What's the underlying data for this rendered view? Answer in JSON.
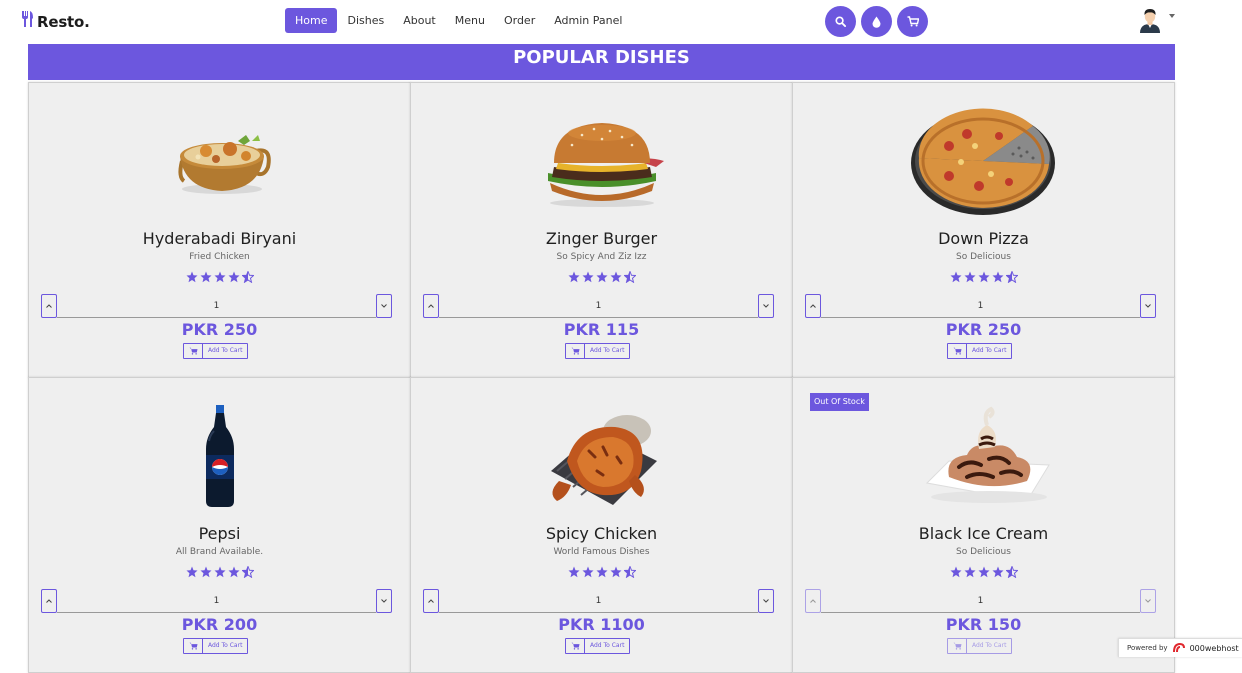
{
  "brand": {
    "name": "Resto.",
    "icon": "fork-knife-icon"
  },
  "nav": {
    "links": [
      {
        "label": "Home",
        "active": true
      },
      {
        "label": "Dishes",
        "active": false
      },
      {
        "label": "About",
        "active": false
      },
      {
        "label": "Menu",
        "active": false
      },
      {
        "label": "Order",
        "active": false
      },
      {
        "label": "Admin Panel",
        "active": false
      }
    ],
    "icons": [
      "search-icon",
      "theme-drop-icon",
      "cart-icon"
    ],
    "user_icon": "user-avatar-icon"
  },
  "banner": {
    "title": "POPULAR DISHES"
  },
  "accent_color": "#6c57de",
  "rating_icon": "star-icon",
  "dishes": [
    {
      "name": "Hyderabadi Biryani",
      "description": "Fried Chicken",
      "rating": 4.5,
      "quantity": "1",
      "price": "PKR 250",
      "cart_label": "Add To Cart",
      "image": "biryani",
      "out_of_stock": false
    },
    {
      "name": "Zinger Burger",
      "description": "So Spicy And Ziz Izz",
      "rating": 4.5,
      "quantity": "1",
      "price": "PKR 115",
      "cart_label": "Add To Cart",
      "image": "burger",
      "out_of_stock": false
    },
    {
      "name": "Down Pizza",
      "description": "So Delicious",
      "rating": 4.5,
      "quantity": "1",
      "price": "PKR 250",
      "cart_label": "Add To Cart",
      "image": "pizza",
      "out_of_stock": false
    },
    {
      "name": "Pepsi",
      "description": "All Brand Available.",
      "rating": 4.5,
      "quantity": "1",
      "price": "PKR 200",
      "cart_label": "Add To Cart",
      "image": "pepsi-bottle",
      "out_of_stock": false
    },
    {
      "name": "Spicy Chicken",
      "description": "World Famous Dishes",
      "rating": 4.5,
      "quantity": "1",
      "price": "PKR 1100",
      "cart_label": "Add To Cart",
      "image": "roast-chicken",
      "out_of_stock": false
    },
    {
      "name": "Black Ice Cream",
      "description": "So Delicious",
      "rating": 4.5,
      "quantity": "1",
      "price": "PKR 150",
      "cart_label": "Add To Cart",
      "image": "ice-cream",
      "out_of_stock": true,
      "badge": "Out Of Stock"
    }
  ],
  "footer_badge": {
    "label": "Powered by",
    "brand": "000webhost"
  }
}
